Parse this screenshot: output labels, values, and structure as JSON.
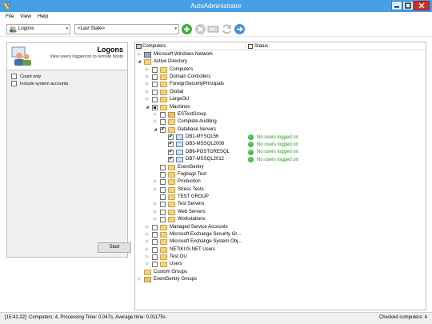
{
  "window": {
    "title": "AutoAdministrator"
  },
  "menu": {
    "file": "File",
    "view": "View",
    "help": "Help"
  },
  "toolbar": {
    "mode_value": "Logons",
    "state_value": "<Last State>"
  },
  "left_panel": {
    "title": "Logons",
    "description": "View users logged on to remote hosts",
    "count_only_label": "Count only",
    "include_system_label": "Include system accounts",
    "start_label": "Start"
  },
  "tree": {
    "col_computers": "Computers",
    "col_status": "Status",
    "rows": [
      {
        "label": "Microsoft Windows Network",
        "depth": 0,
        "expander": "collapsed",
        "checkbox": "none",
        "icon": "network"
      },
      {
        "label": "Active Directory",
        "depth": 0,
        "expander": "expanded",
        "checkbox": "none",
        "icon": "folder"
      },
      {
        "label": "Computers",
        "depth": 1,
        "expander": "collapsed",
        "checkbox": "unchecked",
        "icon": "folder"
      },
      {
        "label": "Domain Controllers",
        "depth": 1,
        "expander": "collapsed",
        "checkbox": "unchecked",
        "icon": "folder"
      },
      {
        "label": "ForeignSecurityPrincipals",
        "depth": 1,
        "expander": "collapsed",
        "checkbox": "unchecked",
        "icon": "folder"
      },
      {
        "label": "Global",
        "depth": 1,
        "expander": "collapsed",
        "checkbox": "unchecked",
        "icon": "folder"
      },
      {
        "label": "LargeOU",
        "depth": 1,
        "expander": "collapsed",
        "checkbox": "unchecked",
        "icon": "folder"
      },
      {
        "label": "Machines",
        "depth": 1,
        "expander": "expanded",
        "checkbox": "partial",
        "icon": "folder"
      },
      {
        "label": "ESTestGroup",
        "depth": 2,
        "expander": "collapsed",
        "checkbox": "unchecked",
        "icon": "group"
      },
      {
        "label": "Complete Auditing",
        "depth": 2,
        "expander": "collapsed",
        "checkbox": "unchecked",
        "icon": "folder"
      },
      {
        "label": "Database Servers",
        "depth": 2,
        "expander": "expanded",
        "checkbox": "checked",
        "icon": "folder"
      },
      {
        "label": "DB1-MYSQL56",
        "depth": 3,
        "expander": "none",
        "checkbox": "checked",
        "icon": "machine",
        "status": "No users logged on"
      },
      {
        "label": "DB3-MSSQL2008",
        "depth": 3,
        "expander": "none",
        "checkbox": "checked",
        "icon": "machine",
        "status": "No users logged on"
      },
      {
        "label": "DB6-POSTGRESQL",
        "depth": 3,
        "expander": "none",
        "checkbox": "checked",
        "icon": "machine",
        "status": "No users logged on"
      },
      {
        "label": "DB7-MSSQL2012",
        "depth": 3,
        "expander": "none",
        "checkbox": "checked",
        "icon": "machine",
        "status": "No users logged on"
      },
      {
        "label": "EventSentry",
        "depth": 2,
        "expander": "none",
        "checkbox": "unchecked",
        "icon": "folder"
      },
      {
        "label": "Fogbugz Test",
        "depth": 2,
        "expander": "none",
        "checkbox": "unchecked",
        "icon": "folder"
      },
      {
        "label": "Production",
        "depth": 2,
        "expander": "collapsed",
        "checkbox": "unchecked",
        "icon": "folder"
      },
      {
        "label": "Stress Tests",
        "depth": 2,
        "expander": "collapsed",
        "checkbox": "unchecked",
        "icon": "folder"
      },
      {
        "label": "TEST GROUP",
        "depth": 2,
        "expander": "none",
        "checkbox": "unchecked",
        "icon": "folder"
      },
      {
        "label": "Test Servers",
        "depth": 2,
        "expander": "collapsed",
        "checkbox": "unchecked",
        "icon": "folder"
      },
      {
        "label": "Web Servers",
        "depth": 2,
        "expander": "collapsed",
        "checkbox": "unchecked",
        "icon": "folder"
      },
      {
        "label": "Workstations",
        "depth": 2,
        "expander": "collapsed",
        "checkbox": "unchecked",
        "icon": "folder"
      },
      {
        "label": "Managed Service Accounts",
        "depth": 1,
        "expander": "collapsed",
        "checkbox": "unchecked",
        "icon": "folder"
      },
      {
        "label": "Microsoft Exchange Security Gr...",
        "depth": 1,
        "expander": "collapsed",
        "checkbox": "unchecked",
        "icon": "folder"
      },
      {
        "label": "Microsoft Exchange System Obj...",
        "depth": 1,
        "expander": "collapsed",
        "checkbox": "unchecked",
        "icon": "folder"
      },
      {
        "label": "NETIKUS.NET Users",
        "depth": 1,
        "expander": "collapsed",
        "checkbox": "unchecked",
        "icon": "folder"
      },
      {
        "label": "Test OU",
        "depth": 1,
        "expander": "collapsed",
        "checkbox": "unchecked",
        "icon": "folder"
      },
      {
        "label": "Users",
        "depth": 1,
        "expander": "collapsed",
        "checkbox": "unchecked",
        "icon": "folder"
      },
      {
        "label": "Custom Groups",
        "depth": 0,
        "expander": "none",
        "checkbox": "none",
        "icon": "folder"
      },
      {
        "label": "EventSentry Groups",
        "depth": 0,
        "expander": "collapsed",
        "checkbox": "none",
        "icon": "group"
      }
    ]
  },
  "statusbar": {
    "left": "[15:41:22]: Computers: 4, Processing Time: 0.047s, Average time: 0.01175s",
    "right": "Checked computers: 4"
  },
  "colors": {
    "titlebar": "#48a0e4",
    "status_ok": "#2a9a2a",
    "close": "#c7302a"
  },
  "icons": {
    "app": "app-icon",
    "minimize": "minimize-icon",
    "maximize": "maximize-icon",
    "close": "close-icon",
    "add": "add-icon",
    "delete": "delete-icon",
    "disk": "disk-icon",
    "refresh": "refresh-icon",
    "forward": "forward-icon",
    "users": "users-icon",
    "status_ok": "check-circle-icon"
  }
}
